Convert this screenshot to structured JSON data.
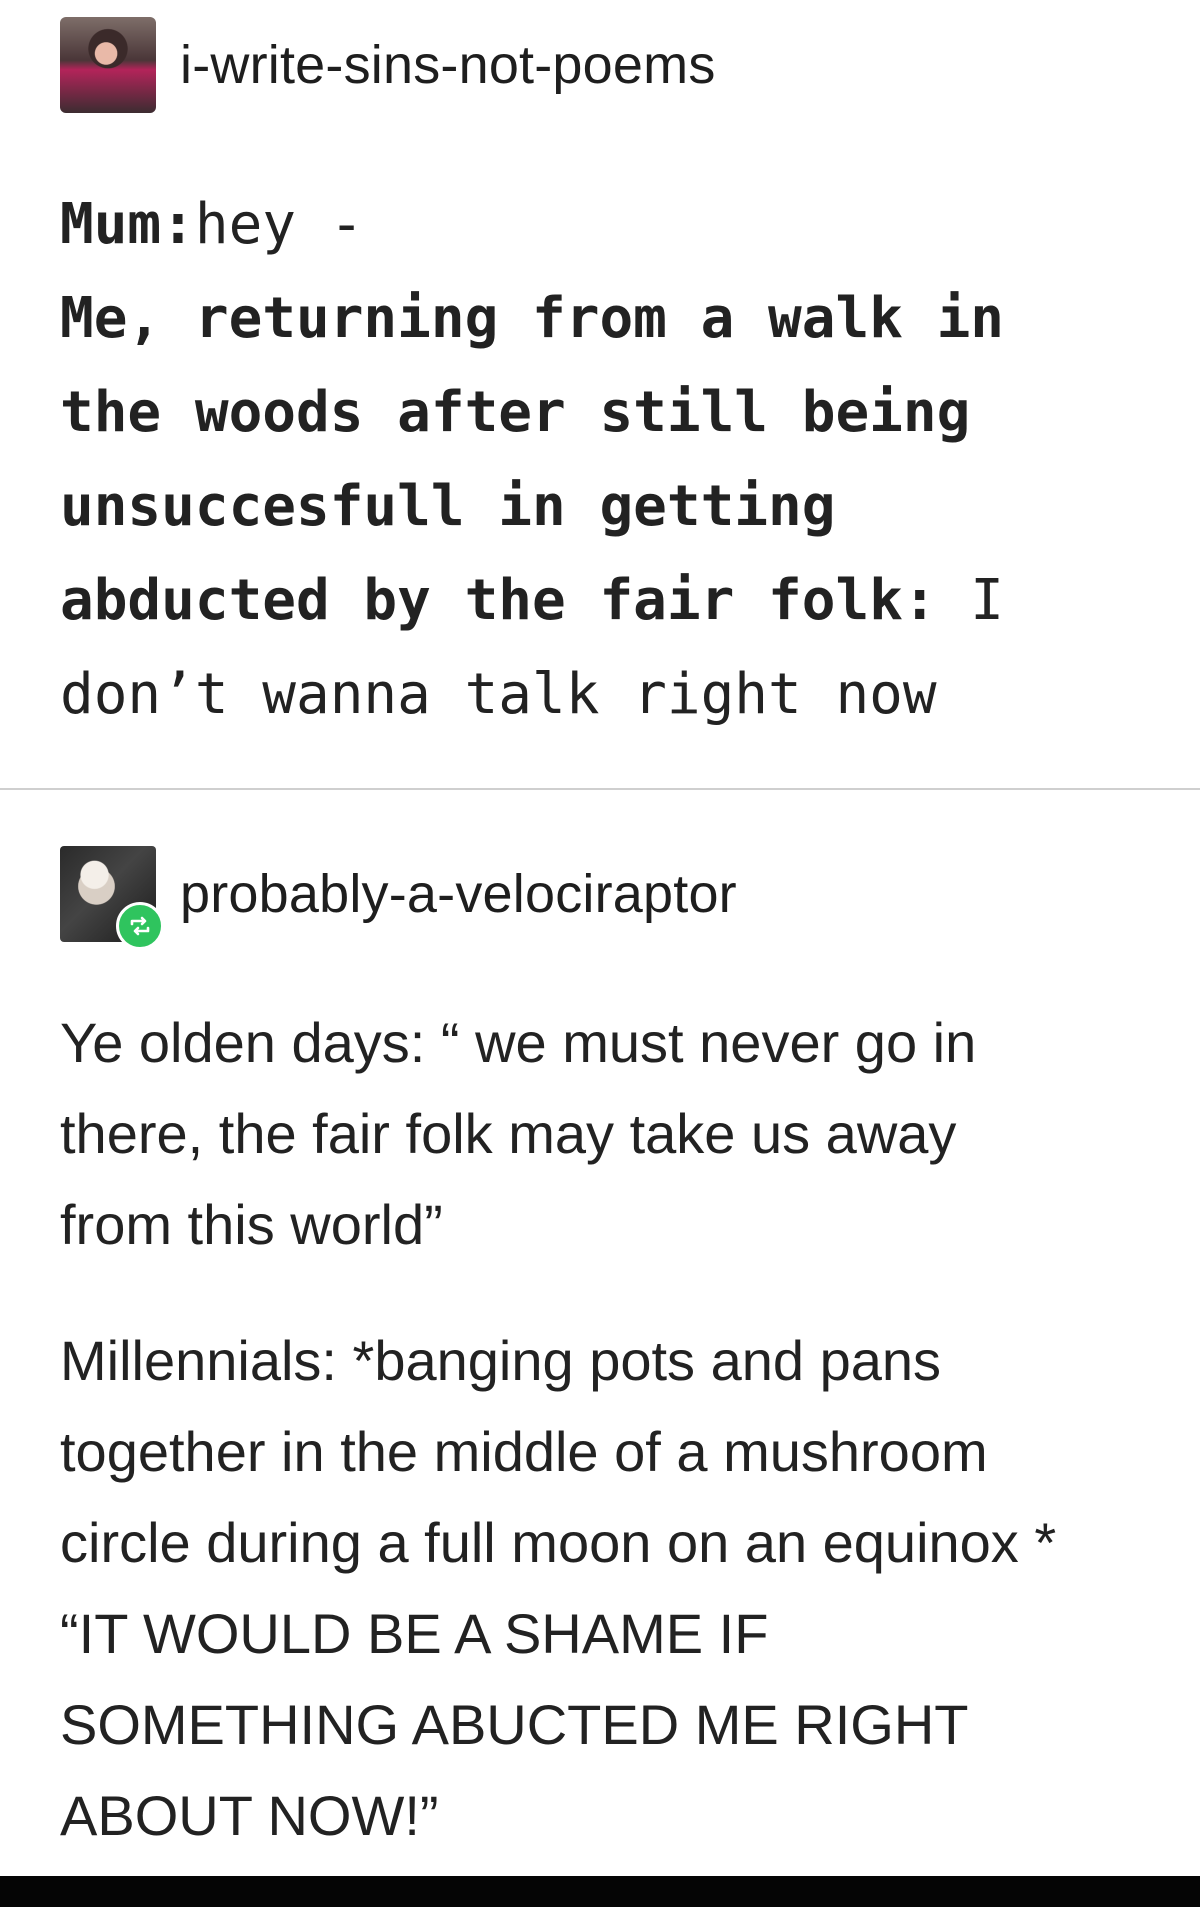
{
  "post1": {
    "username": "i-write-sins-not-poems",
    "lines": [
      {
        "bold": "Mum:",
        "normal": "hey -"
      },
      {
        "bold": "Me, returning from a walk in",
        "normal": ""
      },
      {
        "bold": "the woods after still being",
        "normal": ""
      },
      {
        "bold": "unsuccesfull in getting",
        "normal": ""
      },
      {
        "bold": "abducted by the fair folk:",
        "normal": " I"
      },
      {
        "bold": "",
        "normal": "don’t wanna talk right now"
      }
    ]
  },
  "post2": {
    "username": "probably-a-velociraptor",
    "paragraph1": [
      "Ye olden days: “ we must never go in",
      "there, the fair folk may take us away",
      "from this world”"
    ],
    "paragraph2": [
      "Millennials: *banging pots and pans",
      "together in the middle of a mushroom",
      "circle during a full moon on an equinox *",
      "“IT WOULD BE A SHAME IF",
      "SOMETHING ABUCTED ME RIGHT",
      "ABOUT NOW!”"
    ]
  },
  "colors": {
    "reblog_badge": "#2fc45e",
    "divider": "#cfcfcf",
    "bottom_bar": "#050505"
  },
  "icons": {
    "avatar1": "user-avatar-icon",
    "avatar2": "user-avatar-icon",
    "reblog": "reblog-icon"
  }
}
